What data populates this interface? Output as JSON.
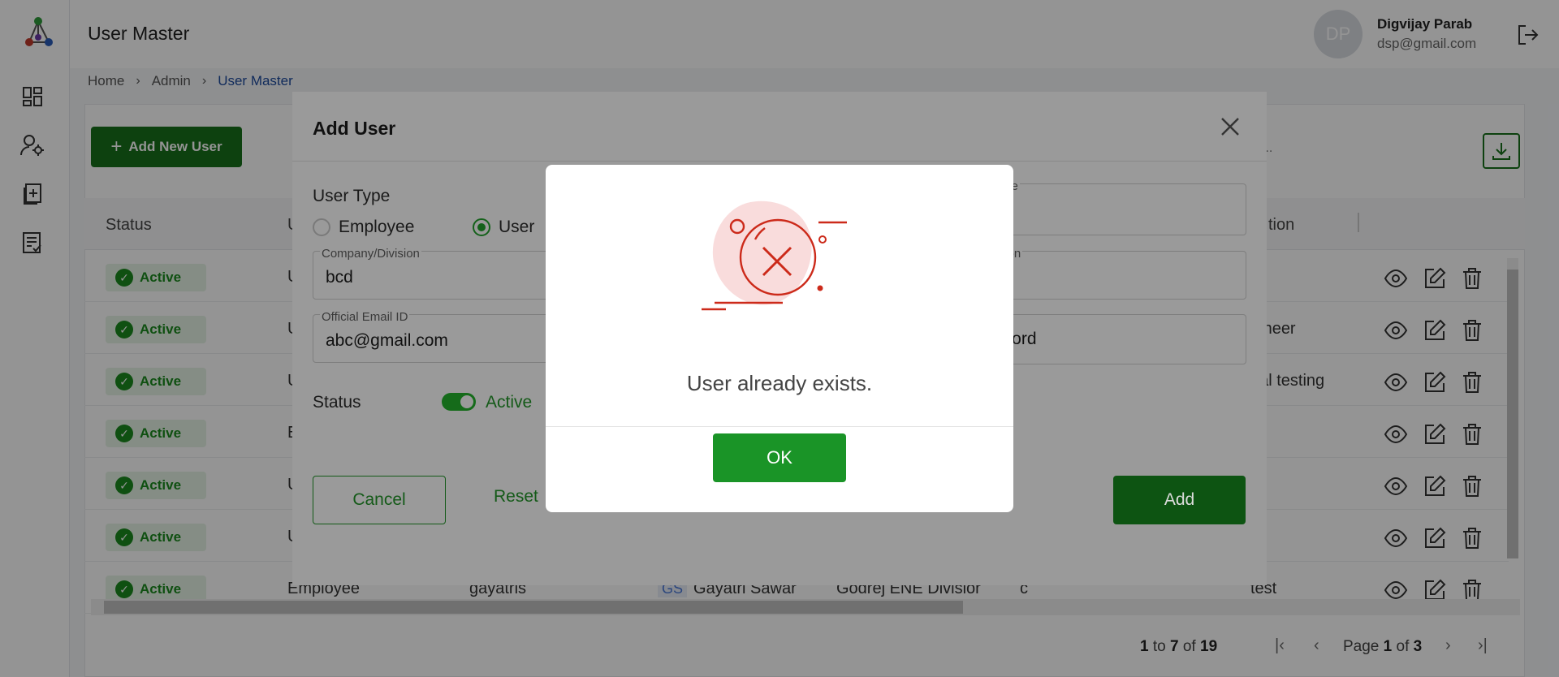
{
  "header": {
    "title": "User Master",
    "avatar_initials": "DP",
    "user_name": "Digvijay Parab",
    "user_email": "dsp@gmail.com"
  },
  "breadcrumb": [
    "Home",
    "Admin",
    "User Master"
  ],
  "toolbar": {
    "add_new_label": "Add New User",
    "search_placeholder": "..."
  },
  "table": {
    "headers": {
      "status": "Status",
      "user_type_partial": "U",
      "designation_partial": "tion"
    },
    "rows": [
      {
        "status": "Active",
        "type": "U",
        "designation": ""
      },
      {
        "status": "Active",
        "type": "U",
        "designation": "gineer"
      },
      {
        "status": "Active",
        "type": "U",
        "designation": "nal testing"
      },
      {
        "status": "Active",
        "type": "E",
        "designation": ""
      },
      {
        "status": "Active",
        "type": "U",
        "designation": ""
      },
      {
        "status": "Active",
        "type": "U",
        "designation": ""
      },
      {
        "status": "Active",
        "type": "Employee",
        "username": "gayatris",
        "initials": "GS",
        "name": "Gayatri Sawar",
        "company": "Godrej ENE Divisior",
        "col6": "c",
        "designation": "test"
      }
    ]
  },
  "pagination": {
    "from": "1",
    "to": "7",
    "total": "19",
    "page": "1",
    "page_count": "3",
    "to_word": "to",
    "of_word": "of",
    "page_word": "Page"
  },
  "add_user_modal": {
    "title": "Add User",
    "user_type_label": "User Type",
    "option_employee": "Employee",
    "option_user": "User",
    "company_label": "Company/Division",
    "company_value": "bcd",
    "email_label": "Official Email ID",
    "email_value": "abc@gmail.com",
    "name_label_partial": "me",
    "designation_label_partial": "tion",
    "password_partial": "word",
    "status_label": "Status",
    "status_value": "Active",
    "cancel_label": "Cancel",
    "reset_label": "Reset",
    "add_label": "Add"
  },
  "alert": {
    "message": "User already exists.",
    "ok_label": "OK"
  },
  "colors": {
    "brand_green": "#17701b",
    "ok_green": "#1a9427",
    "error_red": "#cc2a1a",
    "link_blue": "#1d4a9e"
  }
}
